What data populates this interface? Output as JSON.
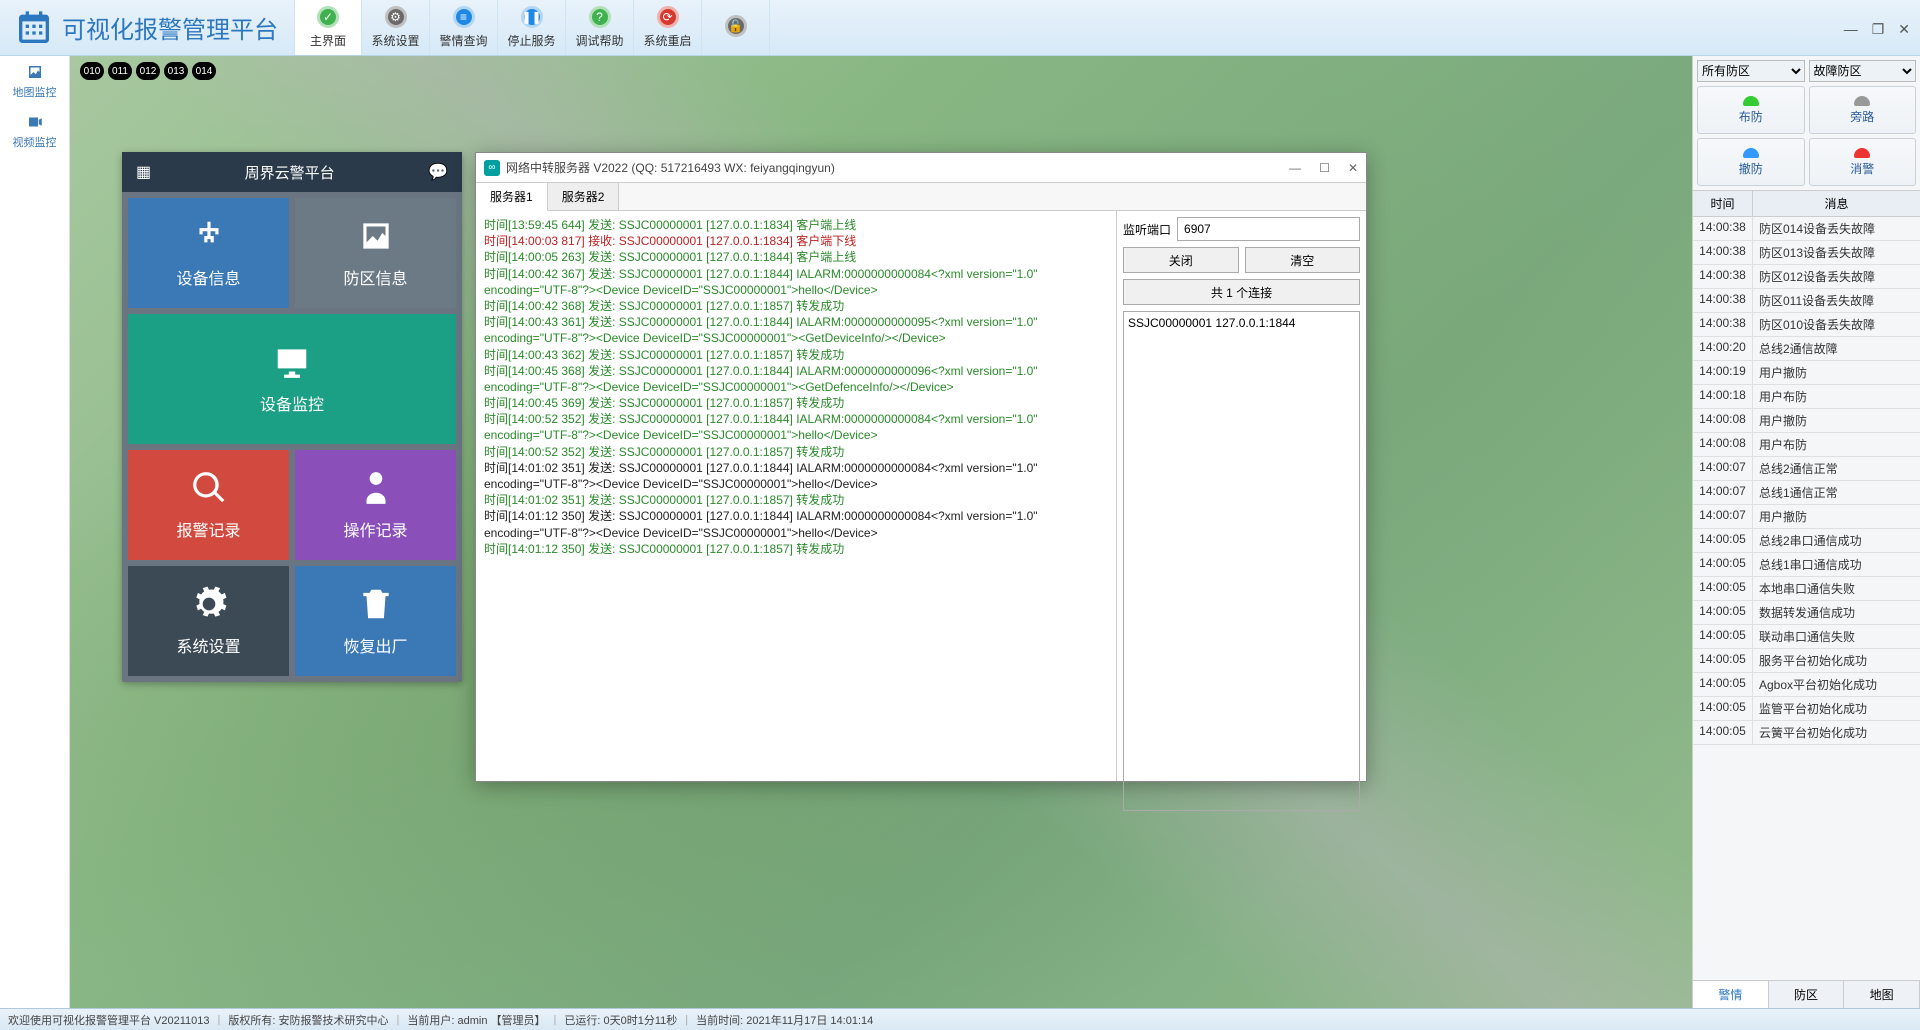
{
  "app": {
    "title": "可视化报警管理平台"
  },
  "toolbar": [
    {
      "label": "主界面",
      "color": "green"
    },
    {
      "label": "系统设置",
      "color": "gray"
    },
    {
      "label": "警情查询",
      "color": "blue"
    },
    {
      "label": "停止服务",
      "color": "blue"
    },
    {
      "label": "调试帮助",
      "color": "green"
    },
    {
      "label": "系统重启",
      "color": "red"
    },
    {
      "label": "",
      "color": "gray"
    }
  ],
  "left_sidebar": [
    {
      "label": "地图监控",
      "icon": "image"
    },
    {
      "label": "视频监控",
      "icon": "video"
    }
  ],
  "chips": [
    "010",
    "011",
    "012",
    "013",
    "014"
  ],
  "tile_panel": {
    "title": "周界云警平台",
    "tiles": [
      {
        "label": "设备信息",
        "color": "c-blue",
        "icon": "sitemap"
      },
      {
        "label": "防区信息",
        "color": "c-gray",
        "icon": "image"
      },
      {
        "label": "设备监控",
        "color": "c-teal",
        "icon": "monitor",
        "monitor": true
      },
      {
        "label": "报警记录",
        "color": "c-red",
        "icon": "search"
      },
      {
        "label": "操作记录",
        "color": "c-purple",
        "icon": "doctor"
      },
      {
        "label": "系统设置",
        "color": "c-dark",
        "icon": "gears"
      },
      {
        "label": "恢复出厂",
        "color": "c-blue",
        "icon": "trash"
      }
    ]
  },
  "dialog": {
    "title": "网络中转服务器 V2022 (QQ: 517216493 WX: feiyangqingyun)",
    "tabs": [
      "服务器1",
      "服务器2"
    ],
    "active_tab": 0,
    "port_label": "监听端口",
    "port_value": "6907",
    "close_btn": "关闭",
    "clear_btn": "清空",
    "conn_btn": "共 1 个连接",
    "conn_list": [
      "SSJC00000001 127.0.0.1:1844"
    ],
    "log": [
      {
        "c": "lg",
        "t": "时间[13:59:45 644] 发送: SSJC00000001 [127.0.0.1:1834] 客户端上线"
      },
      {
        "c": "lr",
        "t": "时间[14:00:03 817] 接收: SSJC00000001 [127.0.0.1:1834] 客户端下线"
      },
      {
        "c": "lg",
        "t": "时间[14:00:05 263] 发送: SSJC00000001 [127.0.0.1:1844] 客户端上线"
      },
      {
        "c": "lg",
        "t": "时间[14:00:42 367] 发送: SSJC00000001 [127.0.0.1:1844] IALARM:0000000000084<?xml version=\"1.0\" encoding=\"UTF-8\"?><Device DeviceID=\"SSJC00000001\">hello</Device>"
      },
      {
        "c": "lg",
        "t": "时间[14:00:42 368] 发送: SSJC00000001 [127.0.0.1:1857] 转发成功"
      },
      {
        "c": "lg",
        "t": "时间[14:00:43 361] 发送: SSJC00000001 [127.0.0.1:1844] IALARM:0000000000095<?xml version=\"1.0\" encoding=\"UTF-8\"?><Device DeviceID=\"SSJC00000001\"><GetDeviceInfo/></Device>"
      },
      {
        "c": "lg",
        "t": "时间[14:00:43 362] 发送: SSJC00000001 [127.0.0.1:1857] 转发成功"
      },
      {
        "c": "lg",
        "t": "时间[14:00:45 368] 发送: SSJC00000001 [127.0.0.1:1844] IALARM:0000000000096<?xml version=\"1.0\" encoding=\"UTF-8\"?><Device DeviceID=\"SSJC00000001\"><GetDefenceInfo/></Device>"
      },
      {
        "c": "lg",
        "t": "时间[14:00:45 369] 发送: SSJC00000001 [127.0.0.1:1857] 转发成功"
      },
      {
        "c": "lg",
        "t": "时间[14:00:52 352] 发送: SSJC00000001 [127.0.0.1:1844] IALARM:0000000000084<?xml version=\"1.0\" encoding=\"UTF-8\"?><Device DeviceID=\"SSJC00000001\">hello</Device>"
      },
      {
        "c": "lg",
        "t": "时间[14:00:52 352] 发送: SSJC00000001 [127.0.0.1:1857] 转发成功"
      },
      {
        "c": "lb",
        "t": "时间[14:01:02 351] 发送: SSJC00000001 [127.0.0.1:1844] IALARM:0000000000084<?xml version=\"1.0\" encoding=\"UTF-8\"?><Device DeviceID=\"SSJC00000001\">hello</Device>"
      },
      {
        "c": "lg",
        "t": "时间[14:01:02 351] 发送: SSJC00000001 [127.0.0.1:1857] 转发成功"
      },
      {
        "c": "lb",
        "t": "时间[14:01:12 350] 发送: SSJC00000001 [127.0.0.1:1844] IALARM:0000000000084<?xml version=\"1.0\" encoding=\"UTF-8\"?><Device DeviceID=\"SSJC00000001\">hello</Device>"
      },
      {
        "c": "lg",
        "t": "时间[14:01:12 350] 发送: SSJC00000001 [127.0.0.1:1857] 转发成功"
      }
    ]
  },
  "right": {
    "select1": "所有防区",
    "select2": "故障防区",
    "btns": [
      {
        "label": "布防",
        "c": "green"
      },
      {
        "label": "旁路",
        "c": "gray"
      },
      {
        "label": "撤防",
        "c": "blue"
      },
      {
        "label": "消警",
        "c": "red"
      }
    ],
    "head_time": "时间",
    "head_msg": "消息",
    "rows": [
      {
        "t": "14:00:38",
        "m": "防区014设备丢失故障"
      },
      {
        "t": "14:00:38",
        "m": "防区013设备丢失故障"
      },
      {
        "t": "14:00:38",
        "m": "防区012设备丢失故障"
      },
      {
        "t": "14:00:38",
        "m": "防区011设备丢失故障"
      },
      {
        "t": "14:00:38",
        "m": "防区010设备丢失故障"
      },
      {
        "t": "14:00:20",
        "m": "总线2通信故障"
      },
      {
        "t": "14:00:19",
        "m": "用户撤防"
      },
      {
        "t": "14:00:18",
        "m": "用户布防"
      },
      {
        "t": "14:00:08",
        "m": "用户撤防"
      },
      {
        "t": "14:00:08",
        "m": "用户布防"
      },
      {
        "t": "14:00:07",
        "m": "总线2通信正常"
      },
      {
        "t": "14:00:07",
        "m": "总线1通信正常"
      },
      {
        "t": "14:00:07",
        "m": "用户撤防"
      },
      {
        "t": "14:00:05",
        "m": "总线2串口通信成功"
      },
      {
        "t": "14:00:05",
        "m": "总线1串口通信成功"
      },
      {
        "t": "14:00:05",
        "m": "本地串口通信失败"
      },
      {
        "t": "14:00:05",
        "m": "数据转发通信成功"
      },
      {
        "t": "14:00:05",
        "m": "联动串口通信失败"
      },
      {
        "t": "14:00:05",
        "m": "服务平台初始化成功"
      },
      {
        "t": "14:00:05",
        "m": "Agbox平台初始化成功"
      },
      {
        "t": "14:00:05",
        "m": "监管平台初始化成功"
      },
      {
        "t": "14:00:05",
        "m": "云簧平台初始化成功"
      }
    ],
    "bottom_tabs": [
      "警情",
      "防区",
      "地图"
    ],
    "bottom_active": 0
  },
  "status": {
    "welcome": "欢迎使用可视化报警管理平台 V20211013",
    "copyright": "版权所有: 安防报警技术研究中心",
    "user": "当前用户: admin 【管理员】",
    "uptime": "已运行: 0天0时1分11秒",
    "time": "当前时间: 2021年11月17日 14:01:14"
  }
}
